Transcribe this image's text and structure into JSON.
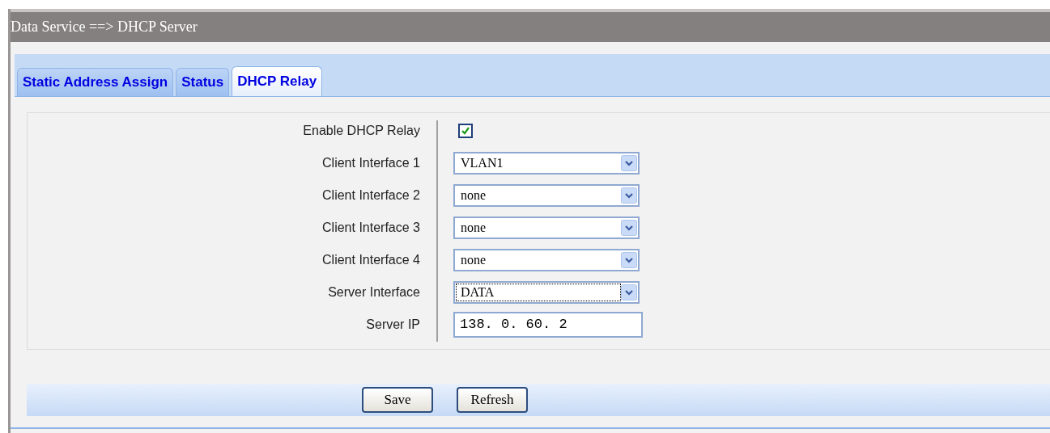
{
  "window": {
    "title": "Data Service ==> DHCP Server"
  },
  "tabs": [
    {
      "label": "Static Address Assign",
      "selected": false
    },
    {
      "label": "Status",
      "selected": false
    },
    {
      "label": "DHCP Relay",
      "selected": true
    }
  ],
  "form": [
    {
      "kind": "checkbox",
      "label": "Enable DHCP Relay",
      "checked": true
    },
    {
      "kind": "select",
      "label": "Client Interface 1",
      "value": "VLAN1",
      "focused": false
    },
    {
      "kind": "select",
      "label": "Client Interface 2",
      "value": "none",
      "focused": false
    },
    {
      "kind": "select",
      "label": "Client Interface 3",
      "value": "none",
      "focused": false
    },
    {
      "kind": "select",
      "label": "Client Interface 4",
      "value": "none",
      "focused": false
    },
    {
      "kind": "select",
      "label": "Server Interface",
      "value": "DATA",
      "focused": true
    },
    {
      "kind": "text",
      "label": "Server IP",
      "value": "138. 0. 60. 2"
    }
  ],
  "buttons": [
    "Save",
    "Refresh"
  ]
}
